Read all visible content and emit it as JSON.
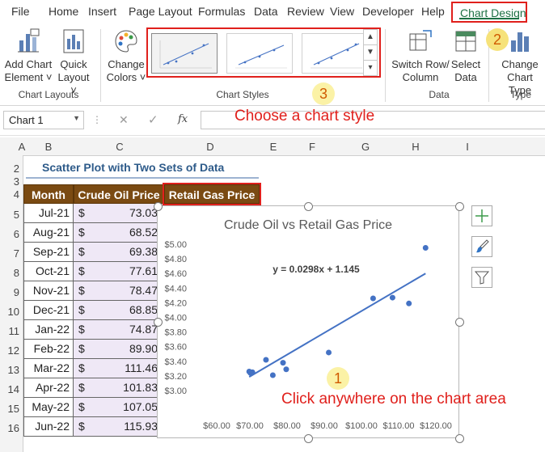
{
  "ribbon_tabs": [
    "File",
    "Home",
    "Insert",
    "Page Layout",
    "Formulas",
    "Data",
    "Review",
    "View",
    "Developer",
    "Help"
  ],
  "active_tab": "Chart Design",
  "ribbon": {
    "add_chart_element": [
      "Add Chart",
      "Element ˅"
    ],
    "quick_layout": [
      "Quick",
      "Layout ˅"
    ],
    "change_colors": [
      "Change",
      "Colors ˅"
    ],
    "switch_row_column": [
      "Switch Row/",
      "Column"
    ],
    "select_data": [
      "Select",
      "Data"
    ],
    "change_chart_type": [
      "Change",
      "Chart Type"
    ],
    "groups": {
      "layouts": "Chart Layouts",
      "styles": "Chart Styles",
      "data": "Data",
      "type": "Type"
    }
  },
  "badges": {
    "one": "1",
    "two": "2",
    "three": "3"
  },
  "formula_bar": {
    "name_box": "Chart 1",
    "fx": "fx",
    "cancel": "✕",
    "enter": "✓"
  },
  "instructions": {
    "style": "Choose a chart style",
    "click": "Click anywhere on the chart area"
  },
  "columns": [
    "A",
    "B",
    "C",
    "D",
    "E",
    "F",
    "G",
    "H",
    "I"
  ],
  "rows": [
    "2",
    "3",
    "4",
    "5",
    "6",
    "7",
    "8",
    "9",
    "10",
    "11",
    "12",
    "13",
    "14",
    "15",
    "16"
  ],
  "sheet_title": "Scatter Plot with Two Sets of Data",
  "table": {
    "headers": [
      "Month",
      "Crude Oil Price",
      "Retail Gas Price"
    ],
    "currency": "$",
    "rows": [
      {
        "month": "Jul-21",
        "oil": "73.03"
      },
      {
        "month": "Aug-21",
        "oil": "68.52"
      },
      {
        "month": "Sep-21",
        "oil": "69.38"
      },
      {
        "month": "Oct-21",
        "oil": "77.61"
      },
      {
        "month": "Nov-21",
        "oil": "78.47"
      },
      {
        "month": "Dec-21",
        "oil": "68.85"
      },
      {
        "month": "Jan-22",
        "oil": "74.87"
      },
      {
        "month": "Feb-22",
        "oil": "89.90"
      },
      {
        "month": "Mar-22",
        "oil": "111.46"
      },
      {
        "month": "Apr-22",
        "oil": "101.83"
      },
      {
        "month": "May-22",
        "oil": "107.05"
      },
      {
        "month": "Jun-22",
        "oil": "115.93"
      }
    ]
  },
  "chart_data": {
    "type": "scatter",
    "title": "Crude Oil vs Retail Gas Price",
    "trendline_label": "y = 0.0298x + 1.145",
    "trendline": {
      "slope": 0.0298,
      "intercept": 1.145
    },
    "xlim": [
      60,
      120
    ],
    "ylim": [
      3.0,
      5.0
    ],
    "xticks": [
      "$60.00",
      "$70.00",
      "$80.00",
      "$90.00",
      "$100.00",
      "$110.00",
      "$120.00"
    ],
    "yticks": [
      "$3.00",
      "$3.20",
      "$3.40",
      "$3.60",
      "$3.80",
      "$4.00",
      "$4.20",
      "$4.40",
      "$4.60",
      "$4.80",
      "$5.00"
    ],
    "series": [
      {
        "points": [
          [
            73.03,
            3.42
          ],
          [
            68.52,
            3.26
          ],
          [
            69.38,
            3.25
          ],
          [
            77.61,
            3.38
          ],
          [
            78.47,
            3.29
          ],
          [
            68.85,
            3.24
          ],
          [
            74.87,
            3.21
          ],
          [
            89.9,
            3.52
          ],
          [
            111.46,
            4.19
          ],
          [
            101.83,
            4.26
          ],
          [
            107.05,
            4.27
          ],
          [
            115.93,
            4.95
          ]
        ]
      }
    ],
    "point_color": "#4472c4",
    "grid": false
  }
}
